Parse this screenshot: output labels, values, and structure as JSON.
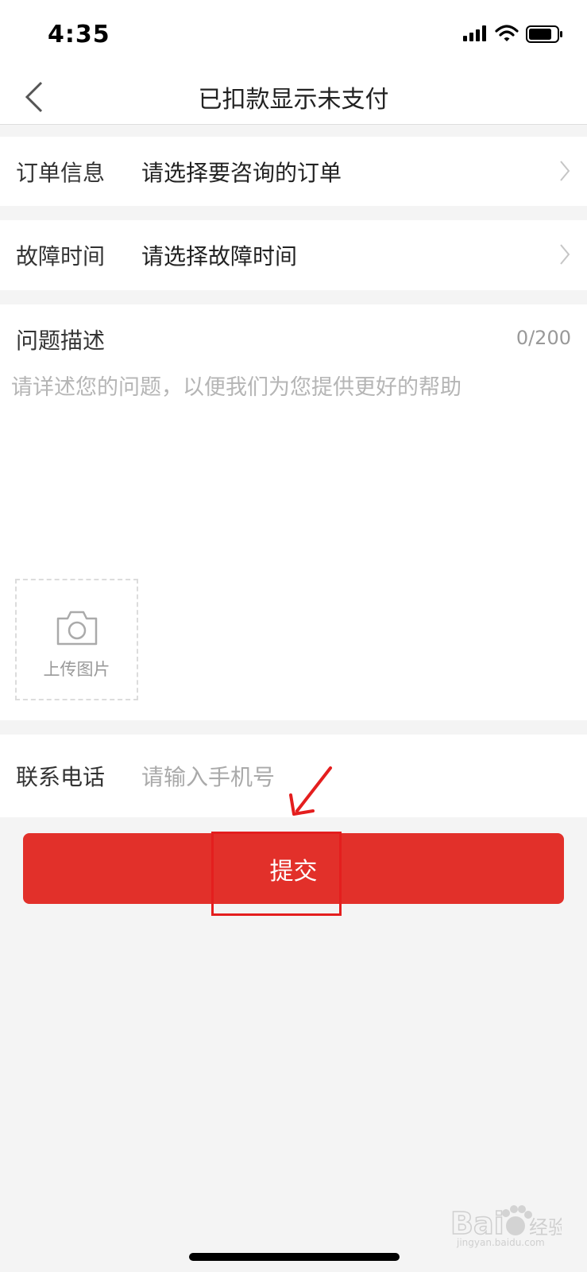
{
  "status": {
    "time": "4:35"
  },
  "nav": {
    "title": "已扣款显示未支付"
  },
  "order": {
    "label": "订单信息",
    "value": "请选择要咨询的订单"
  },
  "fault": {
    "label": "故障时间",
    "value": "请选择故障时间"
  },
  "description": {
    "title": "问题描述",
    "counter": "0/200",
    "placeholder": "请详述您的问题，以便我们为您提供更好的帮助"
  },
  "upload": {
    "label": "上传图片"
  },
  "contact": {
    "label": "联系电话",
    "placeholder": "请输入手机号"
  },
  "submit": {
    "label": "提交"
  },
  "colors": {
    "accent": "#e2302a",
    "annotation": "#e41e1e"
  },
  "watermark": {
    "brand": "Baidu",
    "text": "经验",
    "url": "jingyan.baidu.com"
  }
}
